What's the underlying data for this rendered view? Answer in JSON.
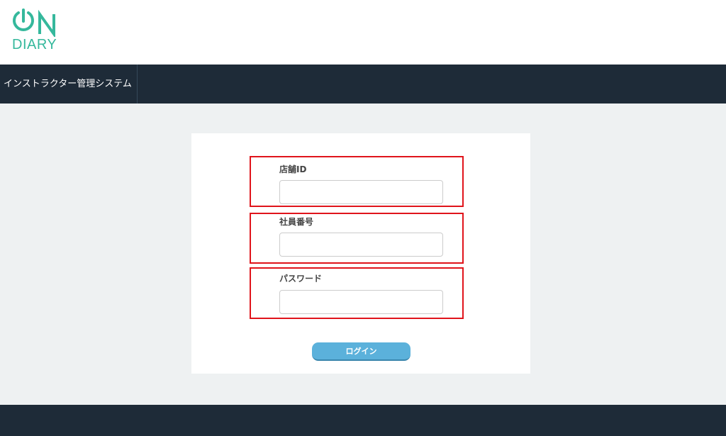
{
  "app": {
    "logo_text_top": "ON",
    "logo_text_bottom": "DIARY",
    "brand_color": "#35b89c"
  },
  "navbar": {
    "title": "インストラクター管理システム"
  },
  "login_form": {
    "fields": [
      {
        "label": "店舗ID",
        "value": "",
        "placeholder": ""
      },
      {
        "label": "社員番号",
        "value": "",
        "placeholder": ""
      },
      {
        "label": "パスワード",
        "value": "",
        "placeholder": ""
      }
    ],
    "submit_label": "ログイン"
  },
  "colors": {
    "navbar_bg": "#1e2b38",
    "content_bg": "#eef1f2",
    "highlight_border": "#e0141b",
    "button_bg": "#5bb1db"
  }
}
